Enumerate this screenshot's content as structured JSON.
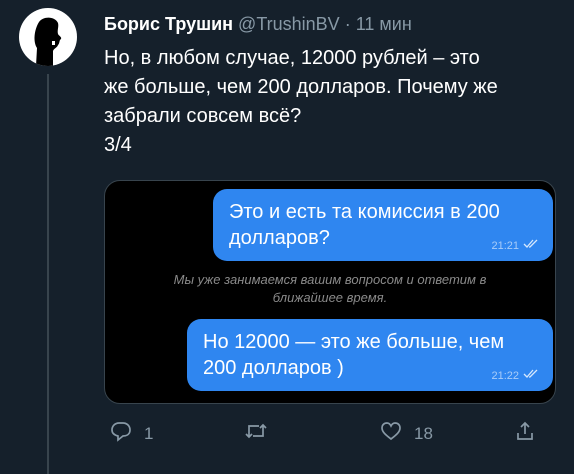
{
  "tweet": {
    "author_name": "Борис Трушин",
    "author_handle": "@TrushinBV",
    "separator": "·",
    "time_ago": "11 мин",
    "text_lines": [
      "Но, в любом случае, 12000 рублей – это",
      "же больше, чем 200 долларов. Почему же",
      "забрали совсем всё?",
      "3/4"
    ]
  },
  "chat": {
    "messages": [
      {
        "lines": [
          "Это и есть та комиссия в 200",
          "долларов?"
        ],
        "time": "21:21",
        "status_icon": "double-check-icon"
      },
      {
        "lines": [
          "Но 12000 — это же больше, чем",
          "200 долларов )"
        ],
        "time": "21:22",
        "status_icon": "double-check-icon"
      }
    ],
    "system_message_lines": [
      "Мы уже занимаемся вашим вопросом и ответим в",
      "ближайшее время."
    ],
    "bubble_color": "#2f86f0",
    "background_color": "#000000"
  },
  "actions": {
    "reply_count": "1",
    "retweet_count": "",
    "like_count": "18",
    "icons": [
      "reply-icon",
      "retweet-icon",
      "like-icon",
      "share-icon"
    ]
  },
  "colors": {
    "background": "#15202b",
    "secondary_text": "#8899a6",
    "divider": "#38444d"
  }
}
